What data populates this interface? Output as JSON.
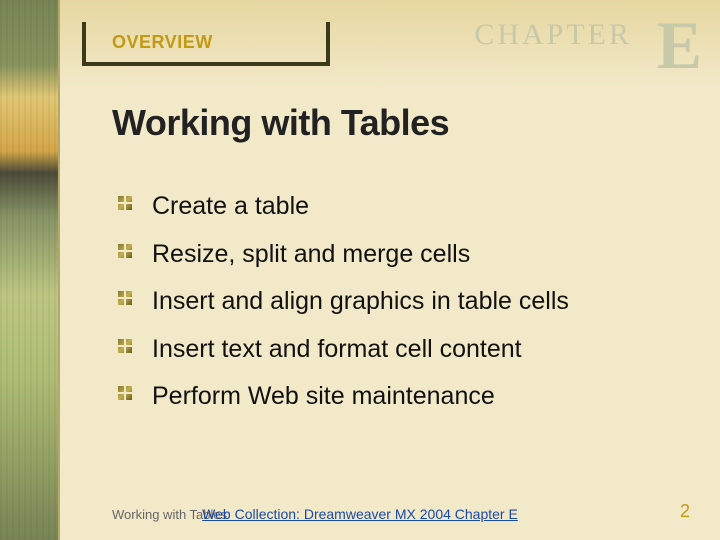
{
  "header": {
    "overview_label": "OVERVIEW",
    "chapter_word": "CHAPTER",
    "chapter_letter": "E"
  },
  "title": "Working with Tables",
  "bullets": [
    "Create a table",
    "Resize, split and merge cells",
    "Insert and align graphics in table cells",
    "Insert text and format cell content",
    "Perform Web site maintenance"
  ],
  "footer": {
    "left": "Working with Tables",
    "center": "Web Collection: Dreamweaver MX 2004 Chapter E",
    "page_number": "2"
  },
  "colors": {
    "accent_gold": "#c29a14",
    "bg_cream": "#f2e9c9",
    "link_blue": "#1a4aa8"
  }
}
